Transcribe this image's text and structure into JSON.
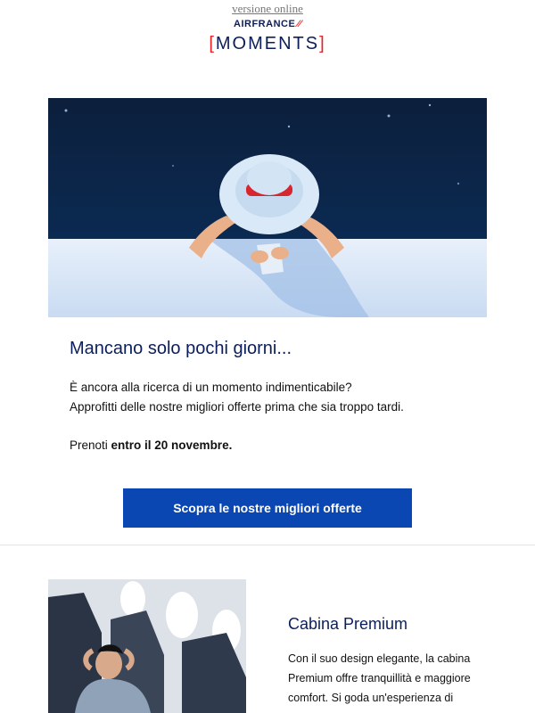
{
  "header": {
    "online_link": "versione online",
    "logo_top": "AIRFRANCE",
    "logo_main": "MOMENTS"
  },
  "hero": {
    "image": "woman-with-sunhat-pool-edge"
  },
  "promo": {
    "headline": "Mancano solo pochi giorni...",
    "line1": "È ancora alla ricerca di un momento indimenticabile?",
    "line2": "Approfitti delle nostre migliori offerte prima che sia troppo tardi.",
    "book_prefix": "Prenoti ",
    "book_bold": "entro il 20 novembre.",
    "cta_label": "Scopra le nostre migliori offerte"
  },
  "cabin": {
    "image": "man-relaxing-premium-seat",
    "title": "Cabina Premium",
    "text": "Con il suo design elegante, la cabina Premium offre tranquillità e maggiore comfort. Si goda un'esperienza di"
  },
  "colors": {
    "brand_navy": "#0b1e5b",
    "brand_red": "#e4232b",
    "cta_blue": "#0a47b3"
  }
}
